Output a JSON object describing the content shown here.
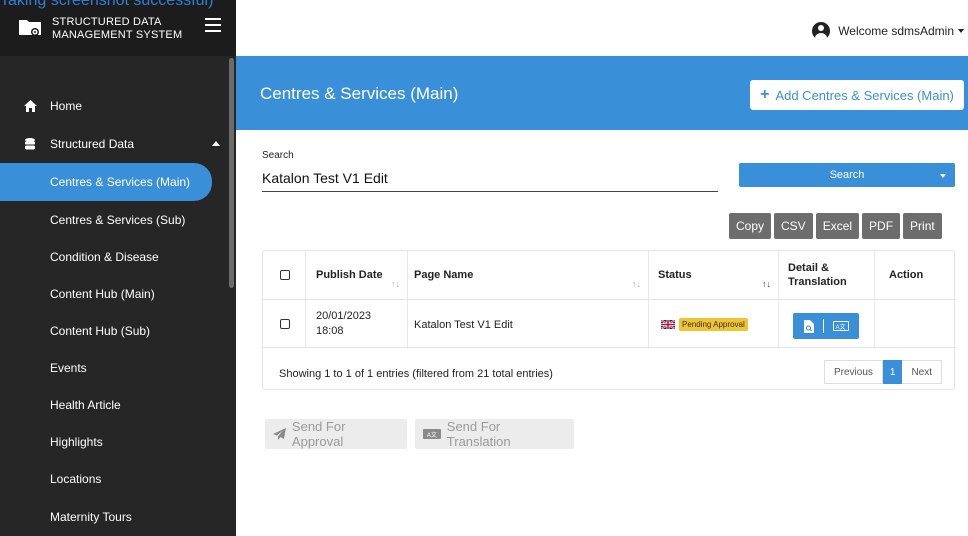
{
  "overlay": {
    "text": "Taking screenshot successful)"
  },
  "brand": {
    "line1": "STRUCTURED DATA",
    "line2": "MANAGEMENT SYSTEM"
  },
  "sidebar": {
    "items": [
      {
        "label": "Home",
        "icon": "home-icon"
      },
      {
        "label": "Structured Data",
        "icon": "database-icon"
      },
      {
        "label": "Centres & Services (Main)",
        "active": true
      },
      {
        "label": "Centres & Services (Sub)"
      },
      {
        "label": "Condition & Disease"
      },
      {
        "label": "Content Hub (Main)"
      },
      {
        "label": "Content Hub (Sub)"
      },
      {
        "label": "Events"
      },
      {
        "label": "Health Article"
      },
      {
        "label": "Highlights"
      },
      {
        "label": "Locations"
      },
      {
        "label": "Maternity Tours"
      }
    ]
  },
  "topbar": {
    "welcome": "Welcome sdmsAdmin"
  },
  "header": {
    "title": "Centres & Services (Main)",
    "add_button": "Add Centres & Services (Main)"
  },
  "search": {
    "label": "Search",
    "value": "Katalon Test V1 Edit",
    "button": "Search"
  },
  "exports": [
    "Copy",
    "CSV",
    "Excel",
    "PDF",
    "Print"
  ],
  "table": {
    "columns": {
      "publish_date": "Publish Date",
      "page_name": "Page Name",
      "status": "Status",
      "detail": "Detail & Translation",
      "action": "Action"
    },
    "rows": [
      {
        "date": "20/01/2023",
        "time": "18:08",
        "page_name": "Katalon Test V1 Edit",
        "status": "Pending Approval"
      }
    ],
    "info": "Showing 1 to 1 of 1 entries (filtered from 21 total entries)",
    "pagination": {
      "previous": "Previous",
      "current": "1",
      "next": "Next"
    }
  },
  "actions": {
    "send_approval": "Send For Approval",
    "send_translation": "Send For Translation"
  },
  "colors": {
    "accent": "#3a8fd9",
    "sidebar": "#262626",
    "badge": "#f1c232"
  }
}
